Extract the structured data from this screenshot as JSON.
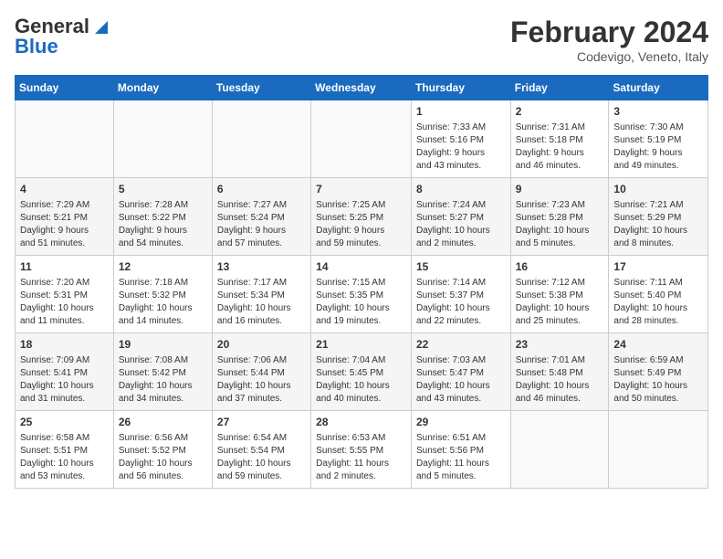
{
  "header": {
    "logo_general": "General",
    "logo_blue": "Blue",
    "month_title": "February 2024",
    "location": "Codevigo, Veneto, Italy"
  },
  "days_of_week": [
    "Sunday",
    "Monday",
    "Tuesday",
    "Wednesday",
    "Thursday",
    "Friday",
    "Saturday"
  ],
  "weeks": [
    [
      {
        "day": "",
        "info": ""
      },
      {
        "day": "",
        "info": ""
      },
      {
        "day": "",
        "info": ""
      },
      {
        "day": "",
        "info": ""
      },
      {
        "day": "1",
        "info": "Sunrise: 7:33 AM\nSunset: 5:16 PM\nDaylight: 9 hours\nand 43 minutes."
      },
      {
        "day": "2",
        "info": "Sunrise: 7:31 AM\nSunset: 5:18 PM\nDaylight: 9 hours\nand 46 minutes."
      },
      {
        "day": "3",
        "info": "Sunrise: 7:30 AM\nSunset: 5:19 PM\nDaylight: 9 hours\nand 49 minutes."
      }
    ],
    [
      {
        "day": "4",
        "info": "Sunrise: 7:29 AM\nSunset: 5:21 PM\nDaylight: 9 hours\nand 51 minutes."
      },
      {
        "day": "5",
        "info": "Sunrise: 7:28 AM\nSunset: 5:22 PM\nDaylight: 9 hours\nand 54 minutes."
      },
      {
        "day": "6",
        "info": "Sunrise: 7:27 AM\nSunset: 5:24 PM\nDaylight: 9 hours\nand 57 minutes."
      },
      {
        "day": "7",
        "info": "Sunrise: 7:25 AM\nSunset: 5:25 PM\nDaylight: 9 hours\nand 59 minutes."
      },
      {
        "day": "8",
        "info": "Sunrise: 7:24 AM\nSunset: 5:27 PM\nDaylight: 10 hours\nand 2 minutes."
      },
      {
        "day": "9",
        "info": "Sunrise: 7:23 AM\nSunset: 5:28 PM\nDaylight: 10 hours\nand 5 minutes."
      },
      {
        "day": "10",
        "info": "Sunrise: 7:21 AM\nSunset: 5:29 PM\nDaylight: 10 hours\nand 8 minutes."
      }
    ],
    [
      {
        "day": "11",
        "info": "Sunrise: 7:20 AM\nSunset: 5:31 PM\nDaylight: 10 hours\nand 11 minutes."
      },
      {
        "day": "12",
        "info": "Sunrise: 7:18 AM\nSunset: 5:32 PM\nDaylight: 10 hours\nand 14 minutes."
      },
      {
        "day": "13",
        "info": "Sunrise: 7:17 AM\nSunset: 5:34 PM\nDaylight: 10 hours\nand 16 minutes."
      },
      {
        "day": "14",
        "info": "Sunrise: 7:15 AM\nSunset: 5:35 PM\nDaylight: 10 hours\nand 19 minutes."
      },
      {
        "day": "15",
        "info": "Sunrise: 7:14 AM\nSunset: 5:37 PM\nDaylight: 10 hours\nand 22 minutes."
      },
      {
        "day": "16",
        "info": "Sunrise: 7:12 AM\nSunset: 5:38 PM\nDaylight: 10 hours\nand 25 minutes."
      },
      {
        "day": "17",
        "info": "Sunrise: 7:11 AM\nSunset: 5:40 PM\nDaylight: 10 hours\nand 28 minutes."
      }
    ],
    [
      {
        "day": "18",
        "info": "Sunrise: 7:09 AM\nSunset: 5:41 PM\nDaylight: 10 hours\nand 31 minutes."
      },
      {
        "day": "19",
        "info": "Sunrise: 7:08 AM\nSunset: 5:42 PM\nDaylight: 10 hours\nand 34 minutes."
      },
      {
        "day": "20",
        "info": "Sunrise: 7:06 AM\nSunset: 5:44 PM\nDaylight: 10 hours\nand 37 minutes."
      },
      {
        "day": "21",
        "info": "Sunrise: 7:04 AM\nSunset: 5:45 PM\nDaylight: 10 hours\nand 40 minutes."
      },
      {
        "day": "22",
        "info": "Sunrise: 7:03 AM\nSunset: 5:47 PM\nDaylight: 10 hours\nand 43 minutes."
      },
      {
        "day": "23",
        "info": "Sunrise: 7:01 AM\nSunset: 5:48 PM\nDaylight: 10 hours\nand 46 minutes."
      },
      {
        "day": "24",
        "info": "Sunrise: 6:59 AM\nSunset: 5:49 PM\nDaylight: 10 hours\nand 50 minutes."
      }
    ],
    [
      {
        "day": "25",
        "info": "Sunrise: 6:58 AM\nSunset: 5:51 PM\nDaylight: 10 hours\nand 53 minutes."
      },
      {
        "day": "26",
        "info": "Sunrise: 6:56 AM\nSunset: 5:52 PM\nDaylight: 10 hours\nand 56 minutes."
      },
      {
        "day": "27",
        "info": "Sunrise: 6:54 AM\nSunset: 5:54 PM\nDaylight: 10 hours\nand 59 minutes."
      },
      {
        "day": "28",
        "info": "Sunrise: 6:53 AM\nSunset: 5:55 PM\nDaylight: 11 hours\nand 2 minutes."
      },
      {
        "day": "29",
        "info": "Sunrise: 6:51 AM\nSunset: 5:56 PM\nDaylight: 11 hours\nand 5 minutes."
      },
      {
        "day": "",
        "info": ""
      },
      {
        "day": "",
        "info": ""
      }
    ]
  ]
}
